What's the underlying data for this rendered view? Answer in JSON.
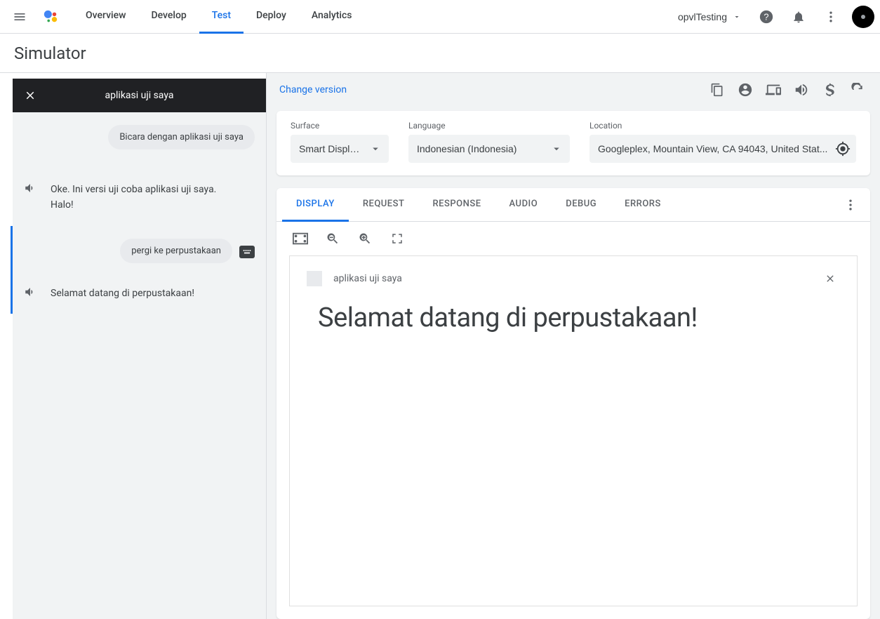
{
  "nav": {
    "overview": "Overview",
    "develop": "Develop",
    "test": "Test",
    "deploy": "Deploy",
    "analytics": "Analytics"
  },
  "project_name": "opvlTesting",
  "page_title": "Simulator",
  "chat": {
    "title": "aplikasi uji saya",
    "messages": [
      {
        "role": "user",
        "text": "Bicara dengan aplikasi uji saya"
      },
      {
        "role": "assistant",
        "text": "Oke. Ini versi uji coba aplikasi uji saya. Halo!"
      },
      {
        "role": "user",
        "text": "pergi ke perpustakaan"
      },
      {
        "role": "assistant",
        "text": "Selamat datang di perpustakaan!"
      }
    ]
  },
  "options": {
    "change_version": "Change version",
    "surface_label": "Surface",
    "surface_value": "Smart Displ…",
    "language_label": "Language",
    "language_value": "Indonesian (Indonesia)",
    "location_label": "Location",
    "location_value": "Googleplex, Mountain View, CA 94043, United Stat..."
  },
  "result_tabs": {
    "display": "DISPLAY",
    "request": "REQUEST",
    "response": "RESPONSE",
    "audio": "AUDIO",
    "debug": "DEBUG",
    "errors": "ERRORS"
  },
  "display_card": {
    "app_name": "aplikasi uji saya",
    "headline": "Selamat datang di perpustakaan!"
  }
}
